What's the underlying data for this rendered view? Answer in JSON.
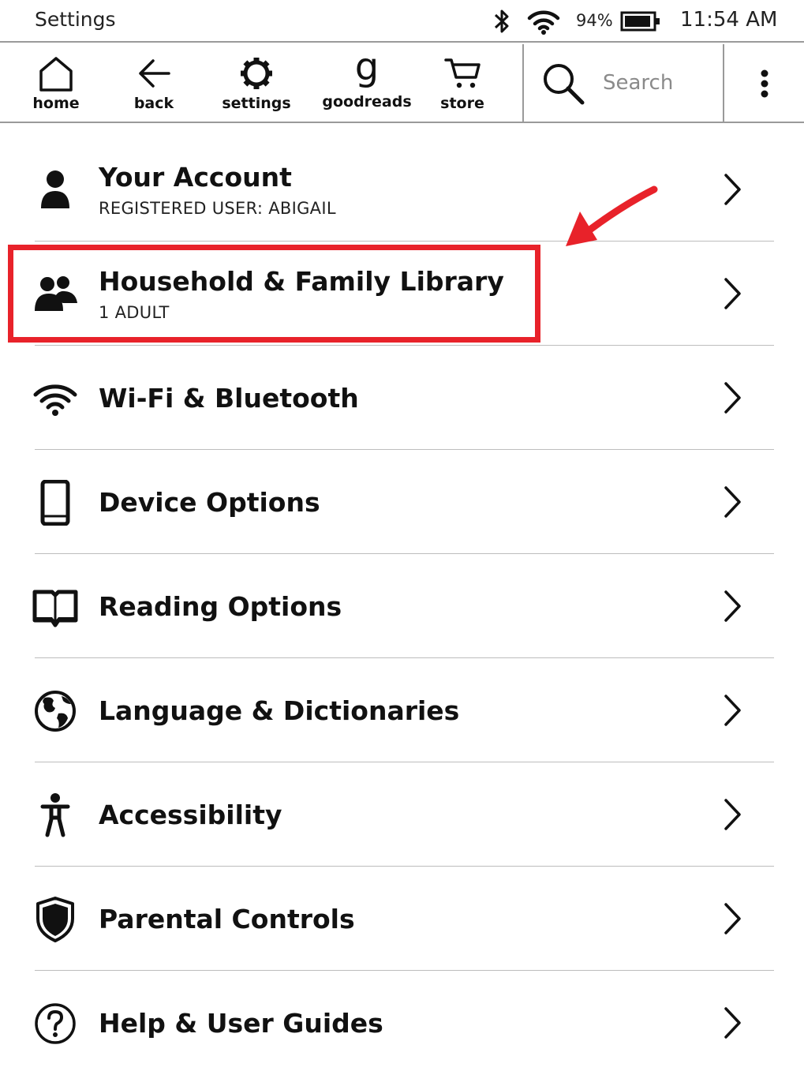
{
  "status_bar": {
    "title": "Settings",
    "battery_percent": "94%",
    "time": "11:54 AM",
    "icons": [
      "bluetooth-icon",
      "wifi-icon",
      "battery-icon"
    ]
  },
  "toolbar": {
    "items": [
      {
        "label": "home",
        "icon": "home-icon"
      },
      {
        "label": "back",
        "icon": "back-arrow-icon"
      },
      {
        "label": "settings",
        "icon": "gear-icon"
      },
      {
        "label": "goodreads",
        "icon": "goodreads-g-icon",
        "glyph": "g"
      },
      {
        "label": "store",
        "icon": "cart-icon"
      }
    ],
    "search_placeholder": "Search",
    "menu_icon": "more-vertical-icon"
  },
  "settings": {
    "items": [
      {
        "title": "Your Account",
        "subtitle": "REGISTERED USER: ABIGAIL",
        "icon": "person-icon"
      },
      {
        "title": "Household & Family Library",
        "subtitle": "1 ADULT",
        "icon": "people-icon"
      },
      {
        "title": "Wi-Fi & Bluetooth",
        "icon": "wifi-icon"
      },
      {
        "title": "Device Options",
        "icon": "tablet-icon"
      },
      {
        "title": "Reading Options",
        "icon": "open-book-icon"
      },
      {
        "title": "Language & Dictionaries",
        "icon": "globe-icon"
      },
      {
        "title": "Accessibility",
        "icon": "accessibility-icon"
      },
      {
        "title": "Parental Controls",
        "icon": "shield-icon"
      },
      {
        "title": "Help & User Guides",
        "icon": "help-icon"
      }
    ]
  },
  "colors": {
    "text": "#111111",
    "divider": "#bdbdbd",
    "placeholder": "#8a8a8a",
    "annotation_red": "#e8222a"
  }
}
